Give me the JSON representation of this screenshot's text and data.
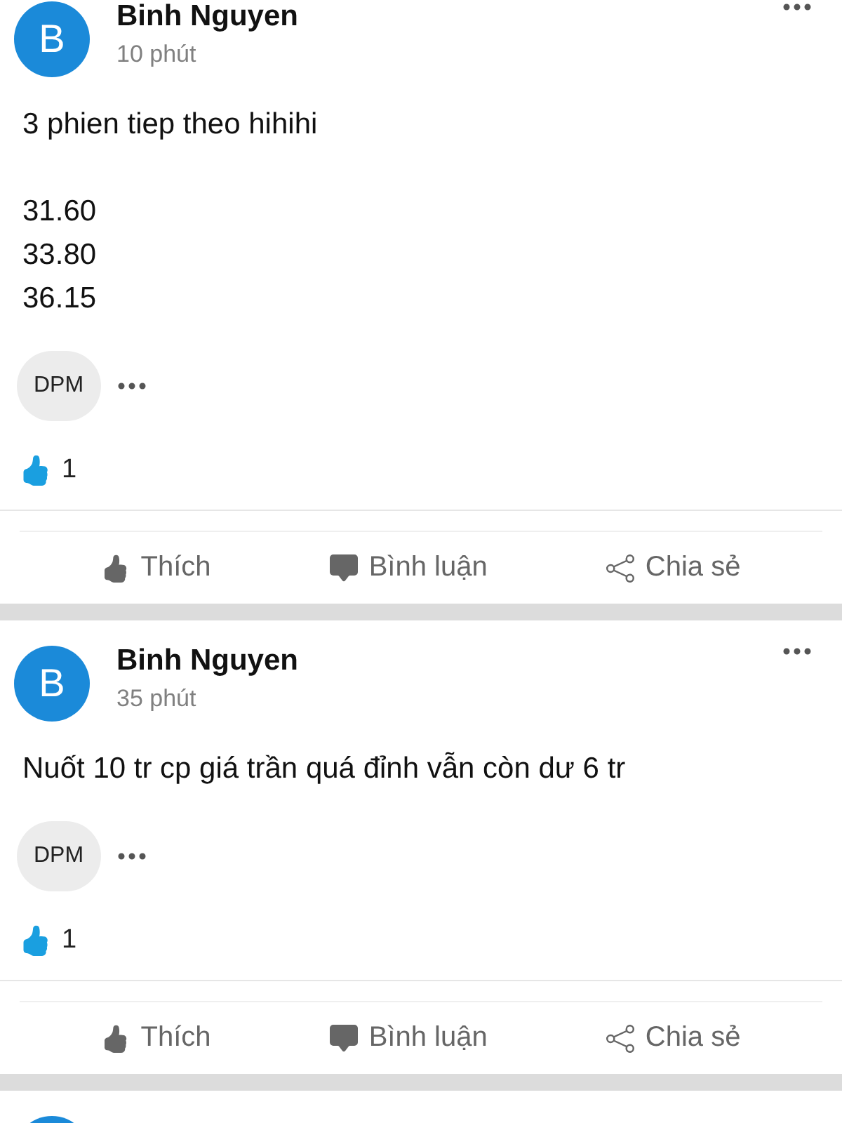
{
  "posts": [
    {
      "kind": "full",
      "avatar_letter": "B",
      "author": "Binh Nguyen",
      "time": "10 phút",
      "body": "3 phien tiep theo hihihi\n\n31.60\n33.80\n36.15",
      "tags": [
        "DPM"
      ],
      "likes": "1",
      "actions": [
        "Thích",
        "Bình luận",
        "Chia sẻ"
      ]
    },
    {
      "kind": "full",
      "avatar_letter": "B",
      "author": "Binh Nguyen",
      "time": "35 phút",
      "body": "Nuốt 10 tr cp giá trần quá đỉnh vẫn còn dư 6 tr",
      "tags": [
        "DPM"
      ],
      "likes": "1",
      "actions": [
        "Thích",
        "Bình luận",
        "Chia sẻ"
      ]
    },
    {
      "kind": "cut"
    }
  ]
}
